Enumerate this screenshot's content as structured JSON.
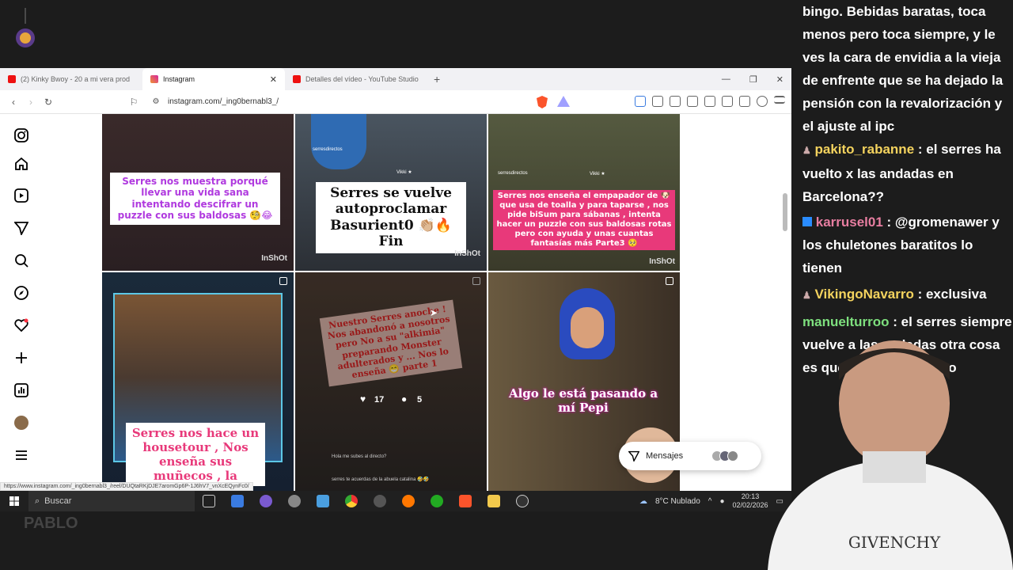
{
  "browser": {
    "tabs": [
      {
        "label": "(2) Kinky Bwoy - 20 a mi vera prod D",
        "favicon": "youtube-icon",
        "color": "#e11"
      },
      {
        "label": "Instagram",
        "favicon": "instagram-icon",
        "color": "#d6249f",
        "active": true
      },
      {
        "label": "Detalles del vídeo - YouTube Studio",
        "favicon": "youtube-icon",
        "color": "#e11"
      }
    ],
    "url": "instagram.com/_ing0bernabl3_/",
    "status_url": "https://www.instagram.com/_ing0bernabl3_/reel/DUQtaRKjDJE7aromGp6P-1J6hV7_vnXcEQynFc0/"
  },
  "instagram": {
    "posts": [
      {
        "caption": "Serres nos muestra porqué llevar una vida sana intentando descifrar un puzzle con sus baldosas 🧐😂",
        "watermark": "InShOt"
      },
      {
        "caption": "Serres se vuelve autoproclamar Basurient0 👏🏼🔥 Fin",
        "watermark": "InShOt",
        "small_text_1": "serresdirectos",
        "small_text_2": "Vikki ★"
      },
      {
        "caption": "Serres nos enseña el empapador de 🐶 que usa de toalla y para taparse , nos pide biSum para sábanas , intenta hacer un puzzle con sus baldosas rotas pero con ayuda y unas cuantas fantasías más Parte3 🥺",
        "watermark": "InShOt",
        "small_text_1": "serresdirectos",
        "small_text_2": "Vikki ★"
      },
      {
        "caption": "Serres nos hace un housetour , Nos enseña sus muñecos , la",
        "watermark": ""
      },
      {
        "caption": "Nuestro Serres anoche ! Nos abandonó a nosotros pero No a su \"alkimia\" preparando Monster adulterados y ... Nos lo enseña 😁 parte 1",
        "likes": "17",
        "comments": "5",
        "comment_1": "Hola me subes al directo?",
        "comment_2": "serres te acuerdas de la abuela catalina 🤣🤣"
      },
      {
        "caption": "Algo le está pasando a mí Pepi",
        "watermark": ""
      }
    ],
    "messages_label": "Mensajes"
  },
  "taskbar": {
    "search_placeholder": "Buscar",
    "weather": "8°C  Nublado",
    "time": "20:13",
    "date": "02/02/2026"
  },
  "chat": {
    "messages": [
      {
        "user": "",
        "text": "bingo. Bebidas baratas, toca menos pero toca siempre, y le ves la cara de envidia a la vieja de enfrente que se ha dejado la pensión con la revalorización y el ajuste al ipc",
        "user_color": "#ffffff"
      },
      {
        "user": "pakito_rabanne",
        "text": ": el serres ha vuelto x las andadas en Barcelona??",
        "user_color": "#f4d35e"
      },
      {
        "user": "karrusel01",
        "text": ": @gromenawer y los chuletones baratitos lo tienen",
        "user_color": "#e87ea1"
      },
      {
        "user": "VikingoNavarro",
        "text": ": exclusiva",
        "user_color": "#f4d35e"
      },
      {
        "user": "manuelturroo",
        "text": ": el serres siempre vuelve a las andadas otra cosa es que lo hiciera directo",
        "user_color": "#7ee07e"
      }
    ]
  },
  "branding": {
    "bottom_logo": "PABLO"
  }
}
